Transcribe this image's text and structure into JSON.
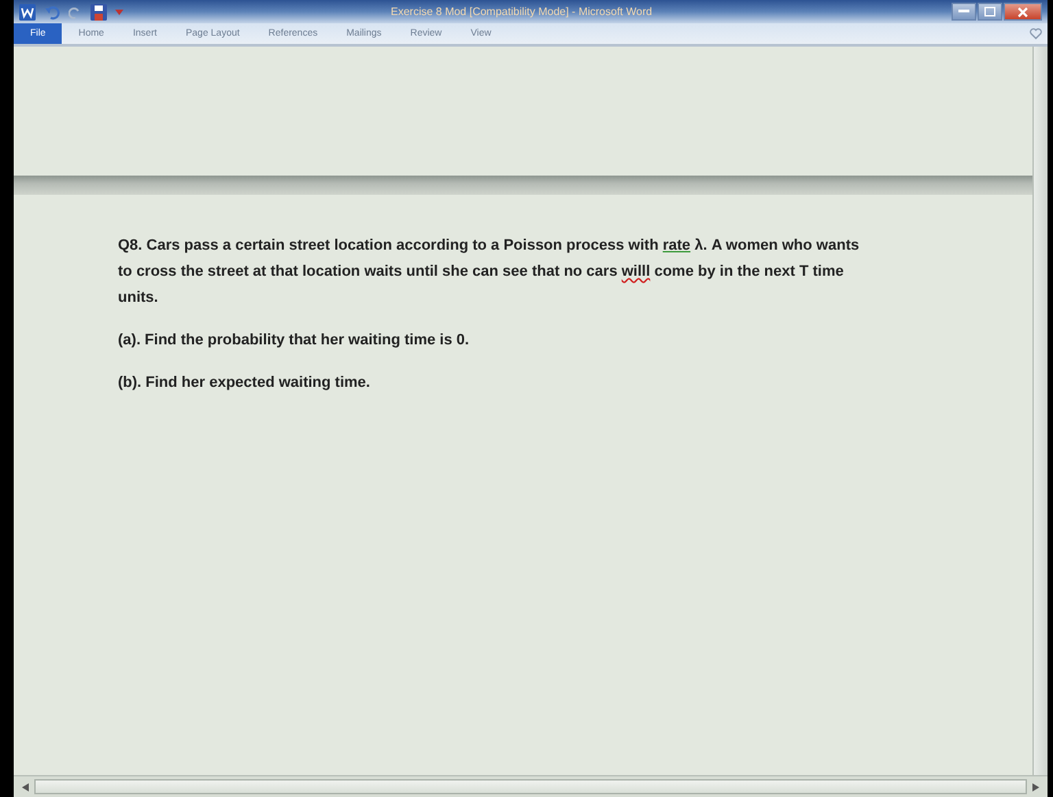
{
  "window": {
    "title": "Exercise 8 Mod [Compatibility Mode] - Microsoft Word"
  },
  "tabs": [
    {
      "label": "File",
      "selected": true
    },
    {
      "label": "Home",
      "selected": false
    },
    {
      "label": "Insert",
      "selected": false
    },
    {
      "label": "Page Layout",
      "selected": false
    },
    {
      "label": "References",
      "selected": false
    },
    {
      "label": "Mailings",
      "selected": false
    },
    {
      "label": "Review",
      "selected": false
    },
    {
      "label": "View",
      "selected": false
    }
  ],
  "document": {
    "paragraphs": [
      {
        "segments": [
          {
            "kind": "text",
            "text": "Q8. Cars pass a certain street location according to a Poisson process with "
          },
          {
            "kind": "grammar",
            "text": "rate"
          },
          {
            "kind": "text",
            "text": " λ. A women who wants to cross the street at that location waits until she can see that no cars "
          },
          {
            "kind": "spelling",
            "text": "willl"
          },
          {
            "kind": "text",
            "text": " come by in the next T time units."
          }
        ]
      },
      {
        "segments": [
          {
            "kind": "text",
            "text": "(a). Find the probability that her waiting time is 0."
          }
        ]
      },
      {
        "segments": [
          {
            "kind": "text",
            "text": "(b). Find her expected waiting time."
          }
        ]
      }
    ]
  }
}
